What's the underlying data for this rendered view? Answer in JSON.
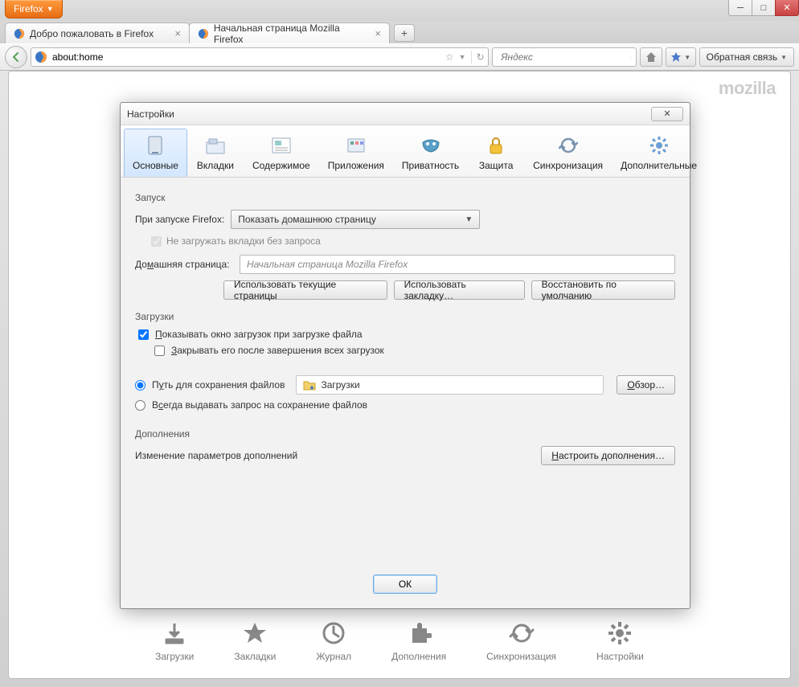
{
  "firefox_menu": "Firefox",
  "window": {
    "min": "─",
    "max": "□",
    "close": "✕"
  },
  "tabs": [
    {
      "label": "Добро пожаловать в Firefox"
    },
    {
      "label": "Начальная страница Mozilla Firefox"
    }
  ],
  "newtab": "+",
  "url": "about:home",
  "search_placeholder": "Яндекс",
  "feedback_label": "Обратная связь",
  "mozilla": "mozilla",
  "bottom": {
    "downloads": "Загрузки",
    "bookmarks": "Закладки",
    "history": "Журнал",
    "addons": "Дополнения",
    "sync": "Синхронизация",
    "settings": "Настройки"
  },
  "dialog": {
    "title": "Настройки",
    "close_glyph": "✕",
    "categories": {
      "general": "Основные",
      "tabs": "Вкладки",
      "content": "Содержимое",
      "apps": "Приложения",
      "privacy": "Приватность",
      "security": "Защита",
      "sync": "Синхронизация",
      "advanced": "Дополнительные"
    },
    "startup": {
      "section": "Запуск",
      "when_start_label": "При запуске Firefox:",
      "when_start_value": "Показать домашнюю страницу",
      "dont_load_tabs": "Не загружать вкладки без запроса",
      "homepage_label": "Домашняя страница:",
      "homepage_value": "Начальная страница Mozilla Firefox",
      "use_current": "Использовать текущие страницы",
      "use_bookmark": "Использовать закладку…",
      "restore_default": "Восстановить по умолчанию"
    },
    "downloads": {
      "section": "Загрузки",
      "show_window": "Показывать окно загрузок при загрузке файла",
      "close_after": "Закрывать его после завершения всех загрузок",
      "save_to_label": "Путь для сохранения файлов",
      "save_to_value": "Загрузки",
      "browse": "Обзор…",
      "always_ask": "Всегда выдавать запрос на сохранение файлов"
    },
    "addons": {
      "section": "Дополнения",
      "desc": "Изменение параметров дополнений",
      "configure": "Настроить дополнения…"
    },
    "ok": "ОК"
  }
}
